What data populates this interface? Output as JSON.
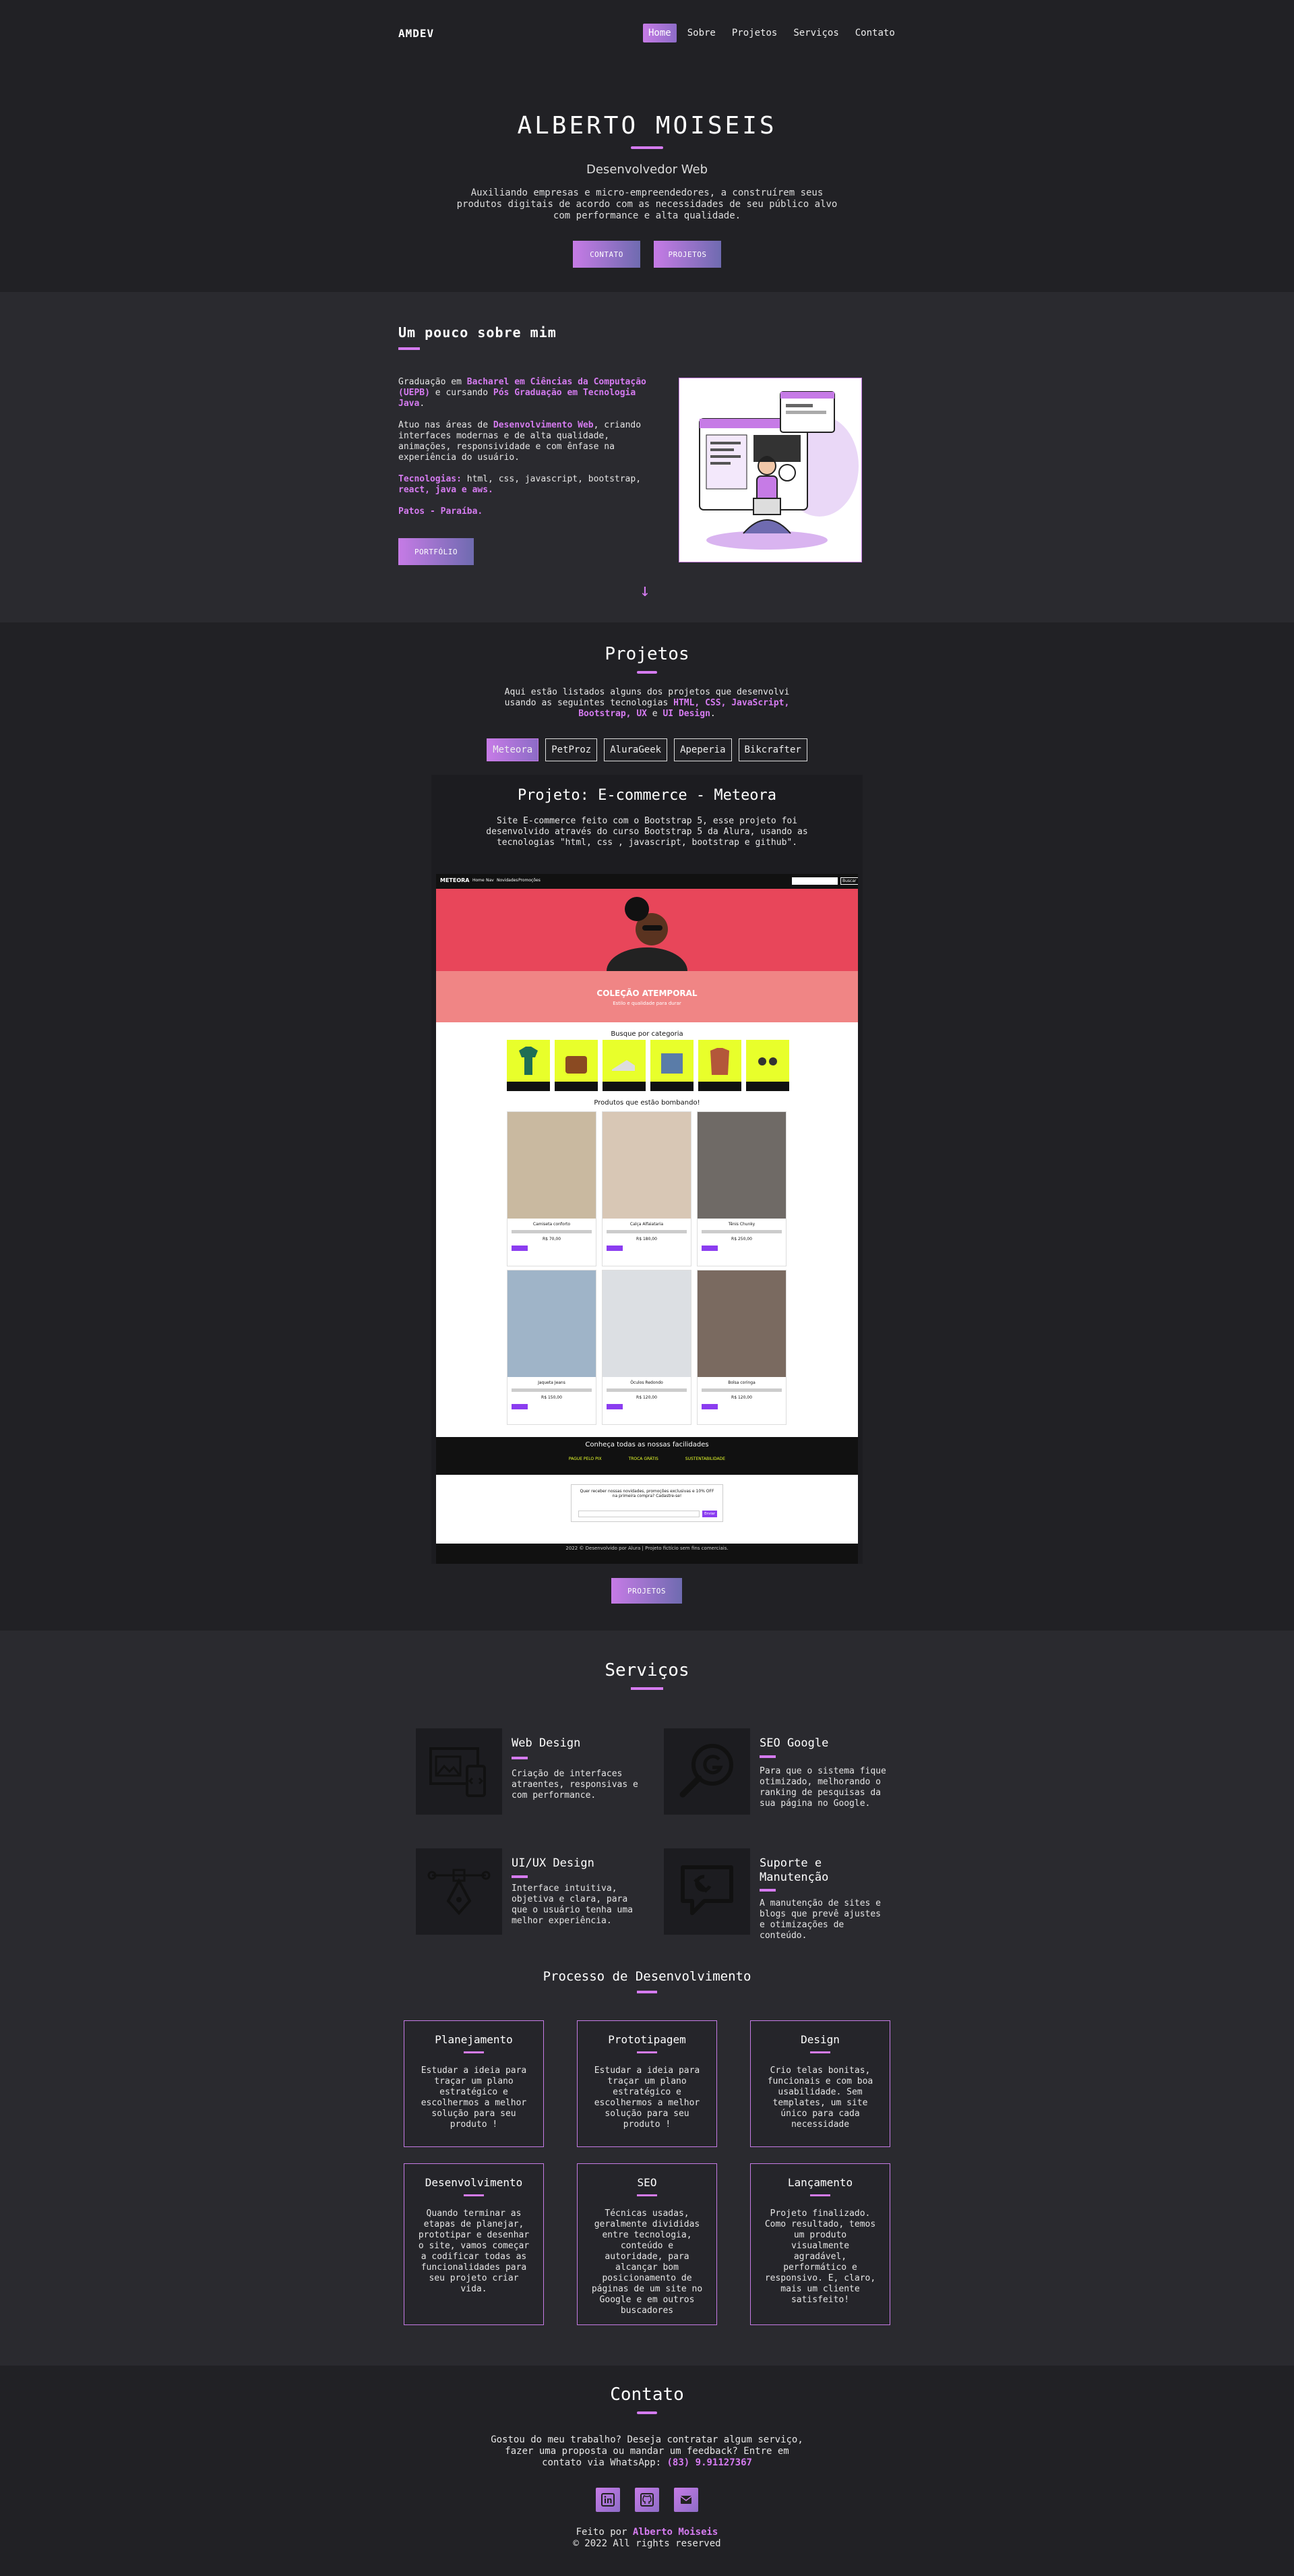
{
  "nav": {
    "logo": "AMDEV",
    "items": [
      "Home",
      "Sobre",
      "Projetos",
      "Serviços",
      "Contato"
    ]
  },
  "hero": {
    "name": "ALBERTO MOISEIS",
    "role": "Desenvolvedor Web",
    "description": "Auxiliando empresas e micro-empreendedores, a construírem seus produtos digitais de acordo com as necessidades de seu público alvo com performance e alta qualidade.",
    "btn_contato": "CONTATO",
    "btn_projetos": "PROJETOS"
  },
  "about": {
    "title": "Um pouco sobre mim",
    "p1_a": "Graduação em ",
    "p1_b": "Bacharel em Ciências da Computação (UEPB)",
    "p1_c": " e cursando ",
    "p1_d": "Pós Graduação em Tecnologia Java",
    "p1_e": ".",
    "p2_a": "Atuo nas áreas de ",
    "p2_b": "Desenvolvimento Web",
    "p2_c": ", criando interfaces modernas e de alta qualidade, animações, responsividade e com ênfase na experiência do usuário.",
    "p3_a": "Tecnologias: ",
    "p3_b": "html, css, javascript, bootstrap, ",
    "p3_c": "react, java e aws.",
    "p4": "Patos - Paraíba.",
    "btn": "PORTFÓLIO"
  },
  "projetos": {
    "title": "Projetos",
    "intro_a": "Aqui estão listados alguns dos projetos que desenvolvi usando as seguintes tecnologias ",
    "intro_b": "HTML, CSS, JavaScript, Bootstrap, UX",
    "intro_c": " e ",
    "intro_d": "UI Design",
    "intro_e": ".",
    "tabs": [
      "Meteora",
      "PetProz",
      "AluraGeek",
      "Apeperia",
      "Bikcrafter"
    ],
    "card_title": "Projeto: E-commerce - Meteora",
    "card_desc": "Site E-commerce feito com o Bootstrap 5, esse projeto foi desenvolvido através do curso Bootstrap 5 da Alura, usando as tecnologias \"html, css , javascript, bootstrap e github\".",
    "shot": {
      "brand": "METEORA",
      "menu": [
        "Home",
        "Nav",
        "Novidades",
        "Promoções"
      ],
      "search_btn": "Buscar",
      "banner_title": "COLEÇÃO ATEMPORAL",
      "banner_sub": "Estilo e qualidade para durar",
      "cat_title": "Busque por categoria",
      "categories": [
        "Camisetas",
        "Bolsas",
        "Calçados",
        "Calças",
        "Casacos",
        "Óculos"
      ],
      "prod_title": "Produtos que estão bombando!",
      "products": [
        "Camiseta conforto",
        "Calça Alfaiataria",
        "Tênis Chunky",
        "Jaqueta Jeans",
        "Óculos Redondo",
        "Bolsa coringa"
      ],
      "prices": [
        "R$ 70,00",
        "R$ 180,00",
        "R$ 250,00",
        "R$ 150,00",
        "R$ 120,00",
        "R$ 120,00"
      ],
      "features_title": "Conheça todas as nossas facilidades",
      "features": [
        "PAGUE PELO PIX",
        "TROCA GRÁTIS",
        "SUSTENTABILIDADE"
      ],
      "newsletter": "Quer receber nossas novidades, promoções exclusivas e 10% OFF na primeira compra? Cadastre-se!",
      "newsletter_btn": "Enviar",
      "footer": "2022 © Desenvolvido por Alura | Projeto fictício sem fins comerciais."
    },
    "btn": "PROJETOS"
  },
  "servicos": {
    "title": "Serviços",
    "items": [
      {
        "title": "Web Design",
        "text": "Criação de interfaces atraentes, responsivas e com performance.",
        "icon": "web-design-icon"
      },
      {
        "title": "SEO Google",
        "text": "Para que o sistema fique otimizado, melhorando o ranking de pesquisas da sua página no Google.",
        "icon": "seo-google-icon"
      },
      {
        "title": "UI/UX Design",
        "text": "Interface intuitiva, objetiva e clara, para que o usuário tenha uma melhor experiência.",
        "icon": "pen-tool-icon"
      },
      {
        "title": "Suporte e Manutenção",
        "text": "A manutenção de sites e blogs que prevê ajustes e otimizações de conteúdo.",
        "icon": "support-icon"
      }
    ],
    "process_title": "Processo de Desenvolvimento",
    "process": [
      {
        "title": "Planejamento",
        "text": "Estudar a ideia para traçar um plano estratégico e escolhermos a melhor solução para seu produto !"
      },
      {
        "title": "Prototipagem",
        "text": "Estudar a ideia para traçar um plano estratégico e escolhermos a melhor solução para seu produto !"
      },
      {
        "title": "Design",
        "text": "Crio telas bonitas, funcionais e com boa usabilidade. Sem templates, um site único para cada necessidade"
      },
      {
        "title": "Desenvolvimento",
        "text": "Quando terminar as etapas de planejar, prototipar e desenhar o site, vamos começar a codificar todas as funcionalidades para seu projeto criar vida."
      },
      {
        "title": "SEO",
        "text": "Técnicas usadas, geralmente divididas entre tecnologia, conteúdo e autoridade, para alcançar bom posicionamento de páginas de um site no Google e em outros buscadores"
      },
      {
        "title": "Lançamento",
        "text": "Projeto finalizado. Como resultado, temos um produto visualmente agradável, performático e responsivo. E, claro, mais um cliente satisfeito!"
      }
    ]
  },
  "contato": {
    "title": "Contato",
    "text": "Gostou do meu trabalho? Deseja contratar algum serviço, fazer uma proposta ou mandar um feedback? Entre em contato via WhatsApp: ",
    "phone": "(83) 9.91127367",
    "footer_a": "Feito por ",
    "footer_b": "Alberto Moiseis",
    "footer_c": "© 2022 All rights reserved"
  },
  "colors": {
    "accent": "#d57bf0",
    "bg": "#212125",
    "bg_alt": "#2a2a2f"
  }
}
